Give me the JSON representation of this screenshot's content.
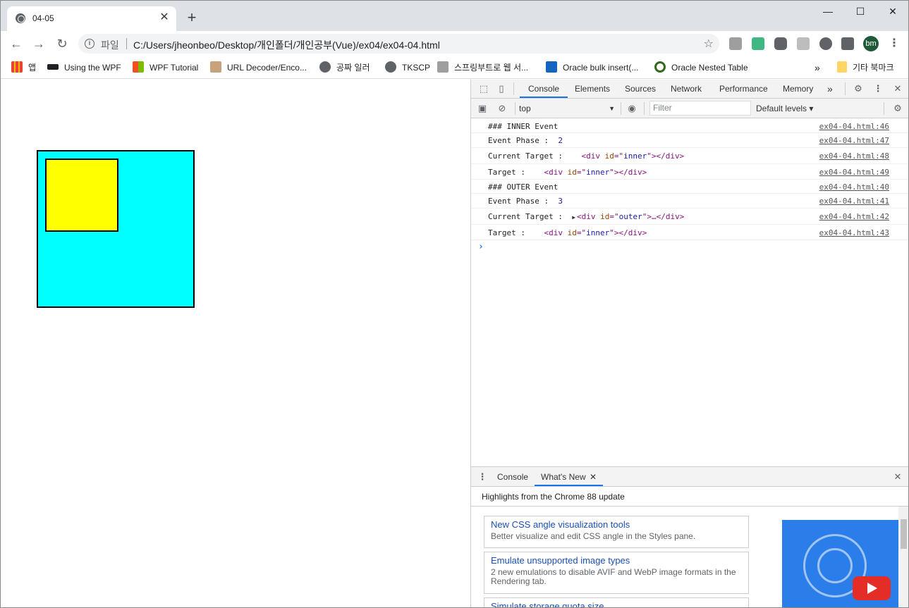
{
  "tab": {
    "title": "04-05",
    "close": "✕"
  },
  "window": {
    "minimize": "—",
    "maximize": "☐",
    "close": "✕"
  },
  "toolbar": {
    "back": "←",
    "forward": "→",
    "reload": "↻",
    "security_label": "파일",
    "url": "C:/Users/jheonbeo/Desktop/개인폴더/개인공부(Vue)/ex04/ex04-04.html",
    "star": "☆",
    "profile": "bm",
    "menu": "⋮",
    "new_tab": "+"
  },
  "bookmarks": [
    {
      "label": "앱",
      "icon": "apps-grid-icon",
      "color": "#ea4335"
    },
    {
      "label": "Using the WPF",
      "icon": "graduation-cap-icon",
      "color": "#202124"
    },
    {
      "label": "WPF Tutorial",
      "icon": "windows-logo-icon",
      "color": "#f25022"
    },
    {
      "label": "URL Decoder/Enco...",
      "icon": "url-decoder-icon",
      "color": "#8d6e63"
    },
    {
      "label": "공짜 일러",
      "icon": "globe-icon",
      "color": "#5f6368"
    },
    {
      "label": "TKSCP",
      "icon": "globe-icon",
      "color": "#5f6368"
    },
    {
      "label": "스프링부트로 웹 서...",
      "icon": "book-icon",
      "color": "#757575"
    },
    {
      "label": "Oracle bulk insert(...",
      "icon": "d-logo-icon",
      "color": "#1565c0"
    },
    {
      "label": "Oracle Nested Table",
      "icon": "circle-logo-icon",
      "color": "#33691e"
    }
  ],
  "bookmarks_overflow": "»",
  "other_bookmarks": "기타 북마크",
  "devtools": {
    "tabs": [
      "Console",
      "Elements",
      "Sources",
      "Network",
      "Performance",
      "Memory"
    ],
    "more_tabs": "»",
    "context": "top",
    "filter_placeholder": "Filter",
    "levels": "Default levels ▾",
    "close": "✕"
  },
  "console": [
    {
      "text": "### INNER Event",
      "src": "ex04-04.html:46"
    },
    {
      "text": "Event Phase :  ",
      "num": "2",
      "src": "ex04-04.html:47"
    },
    {
      "text": "Current Target :    ",
      "el": "inner",
      "expandable": false,
      "src": "ex04-04.html:48"
    },
    {
      "text": "Target :    ",
      "el": "inner",
      "expandable": false,
      "src": "ex04-04.html:49"
    },
    {
      "text": "### OUTER Event",
      "src": "ex04-04.html:40"
    },
    {
      "text": "Event Phase :  ",
      "num": "3",
      "src": "ex04-04.html:41"
    },
    {
      "text": "Current Target :  ",
      "el": "outer",
      "expandable": true,
      "src": "ex04-04.html:42"
    },
    {
      "text": "Target :    ",
      "el": "inner",
      "expandable": false,
      "src": "ex04-04.html:43"
    }
  ],
  "drawer": {
    "tabs": [
      "Console",
      "What's New"
    ],
    "close": "✕",
    "highlights": "Highlights from the Chrome 88 update",
    "cards": [
      {
        "title": "New CSS angle visualization tools",
        "desc": "Better visualize and edit CSS angle in the Styles pane."
      },
      {
        "title": "Emulate unsupported image types",
        "desc": "2 new emulations to disable AVIF and WebP image formats in the Rendering tab."
      },
      {
        "title": "Simulate storage quota size",
        "desc": ""
      }
    ]
  },
  "colors": {
    "outer": "#00ffff",
    "inner": "#ffff00",
    "accent": "#1a73e8"
  }
}
